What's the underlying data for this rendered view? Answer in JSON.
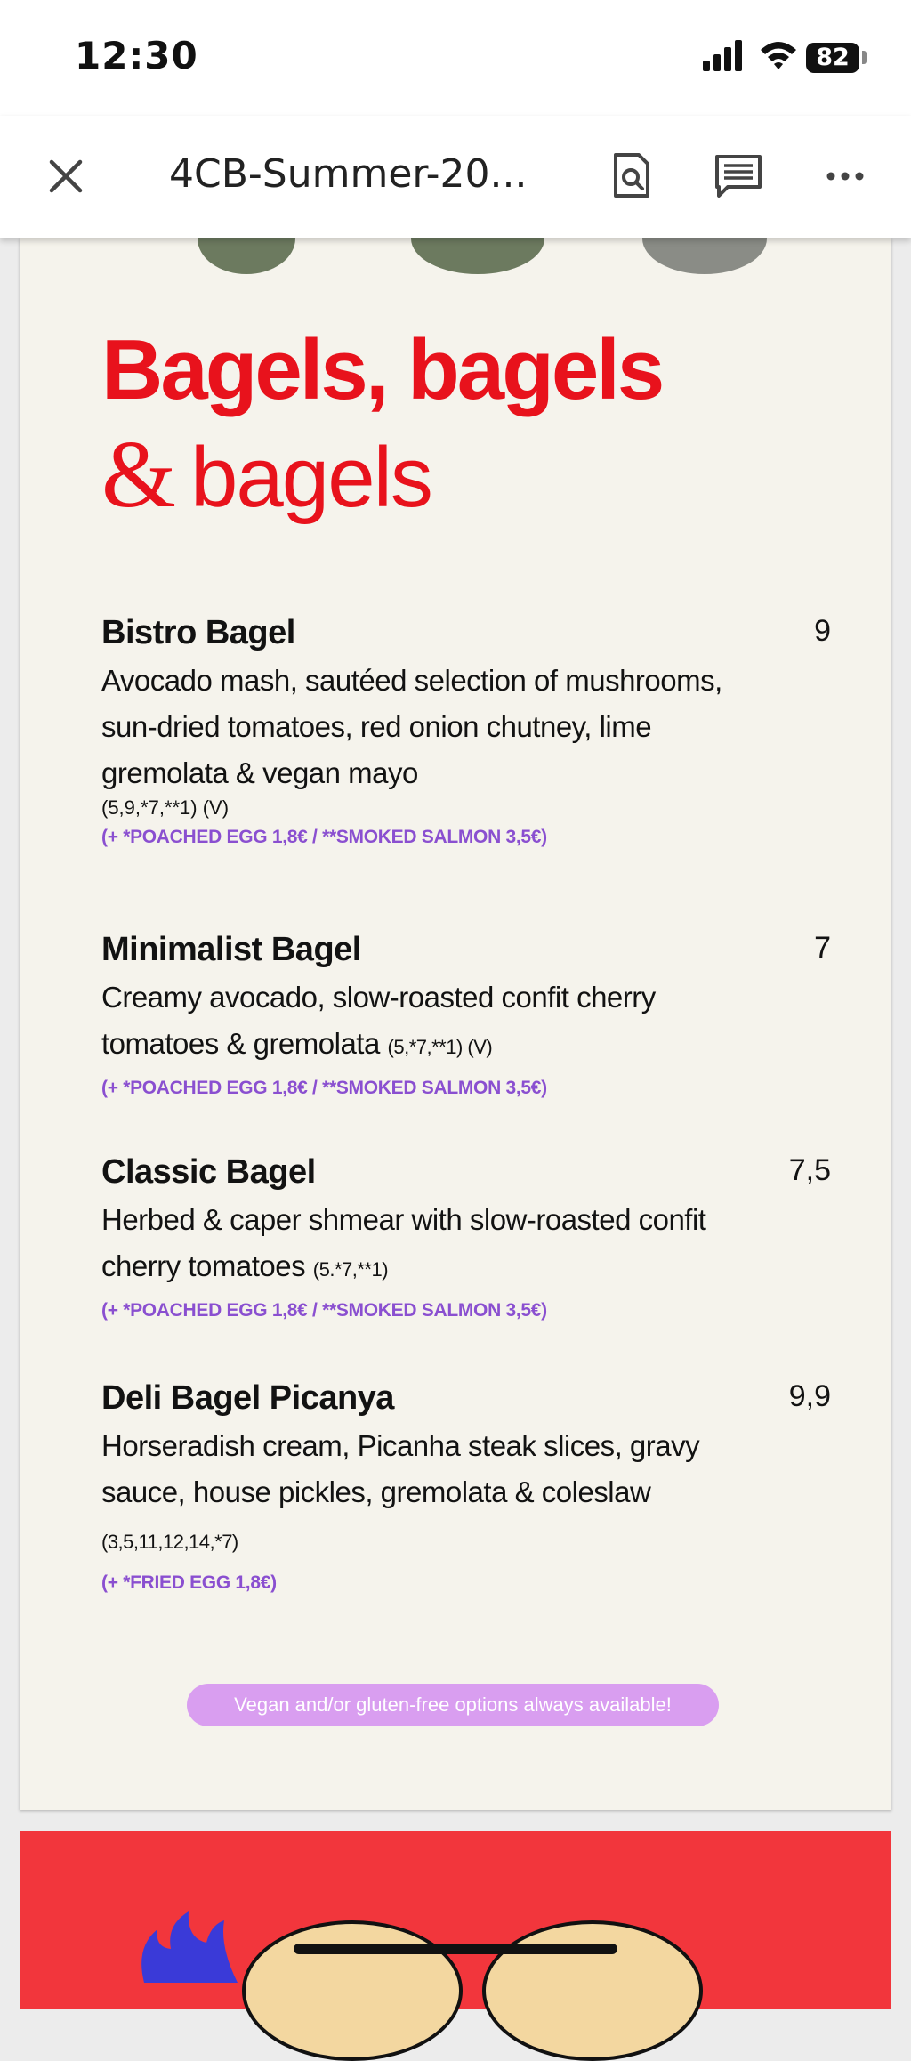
{
  "status_bar": {
    "time": "12:30",
    "battery": "82"
  },
  "app_bar": {
    "title": "4CB-Summer-20..."
  },
  "menu": {
    "heading_line1": "Bagels, bagels",
    "heading_amp": "&",
    "heading_line2": "bagels",
    "items": [
      {
        "name": "Bistro Bagel",
        "price": "9",
        "desc": "Avocado mash, sautéed selection of mushrooms, sun-dried tomatoes, red onion chutney, lime gremolata & vegan mayo",
        "allergens": "(5,9,*7,**1) (V)",
        "addons": "(+ *POACHED EGG 1,8€  /  **SMOKED SALMON 3,5€)"
      },
      {
        "name": "Minimalist Bagel",
        "price": "7",
        "desc": "Creamy avocado, slow-roasted confit cherry tomatoes & gremolata",
        "allergens": "(5,*7,**1) (V)",
        "addons": "(+ *POACHED EGG 1,8€  /  **SMOKED SALMON 3,5€)"
      },
      {
        "name": "Classic Bagel",
        "price": "7,5",
        "desc": "Herbed & caper shmear with slow-roasted confit cherry tomatoes",
        "allergens": "(5.*7,**1)",
        "addons": "(+ *POACHED EGG 1,8€  /  **SMOKED SALMON 3,5€)"
      },
      {
        "name": "Deli Bagel Picanya",
        "price": "9,9",
        "desc": "Horseradish cream, Picanha steak slices, gravy sauce, house pickles, gremolata & coleslaw",
        "allergens": "(3,5,11,12,14,*7)",
        "addons": "(+ *FRIED EGG 1,8€)"
      }
    ],
    "vegan_note": "Vegan and/or gluten-free options always available!"
  },
  "colors": {
    "accent_red": "#e8121c",
    "addon_purple": "#8a4fd0",
    "pill": "#d99ef0"
  }
}
